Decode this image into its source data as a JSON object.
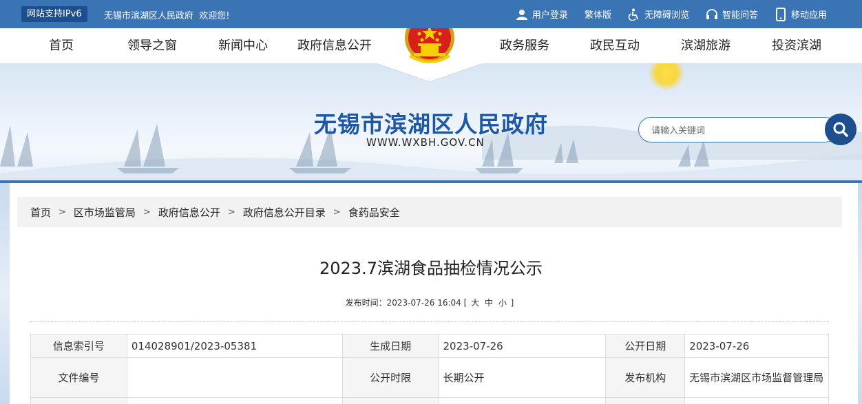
{
  "topbar": {
    "ipv6_badge": "网站支持IPv6",
    "welcome": "无锡市滨湖区人民政府  欢迎您!",
    "links": [
      {
        "label": "用户登录",
        "icon": "user-icon"
      },
      {
        "label": "繁体版",
        "icon": ""
      },
      {
        "label": "无障碍浏览",
        "icon": "accessibility-icon"
      },
      {
        "label": "智能问答",
        "icon": "headset-icon"
      },
      {
        "label": "移动应用",
        "icon": "mobile-icon"
      }
    ]
  },
  "nav": {
    "items": [
      "首页",
      "领导之窗",
      "新闻中心",
      "政府信息公开",
      "政务服务",
      "政民互动",
      "滨湖旅游",
      "投资滨湖"
    ]
  },
  "banner": {
    "site_title": "无锡市滨湖区人民政府",
    "site_url": "WWW.WXBH.GOV.CN",
    "search_placeholder": "请输入关键词"
  },
  "breadcrumb": [
    "首页",
    "区市场监管局",
    "政府信息公开",
    "政府信息公开目录",
    "食药品安全"
  ],
  "breadcrumb_sep": ">",
  "article": {
    "title": "2023.7滨湖食品抽检情况公示",
    "publish_label": "发布时间：",
    "publish_time": "2023-07-26 16:04",
    "size_open": "[",
    "size_large": "大",
    "size_medium": "中",
    "size_small": "小",
    "size_close": "]"
  },
  "info_table": {
    "row1": {
      "l1": "信息索引号",
      "v1": "014028901/2023-05381",
      "l2": "生成日期",
      "v2": "2023-07-26",
      "l3": "公开日期",
      "v3": "2023-07-26"
    },
    "row2": {
      "l1": "文件编号",
      "v1": "",
      "l2": "公开时限",
      "v2": "长期公开",
      "l3": "发布机构",
      "v3": "无锡市滨湖区市场监督管理局"
    }
  },
  "colors": {
    "primary": "#3a74b5",
    "dark": "#1d4f8e",
    "title": "#1d58a6"
  }
}
